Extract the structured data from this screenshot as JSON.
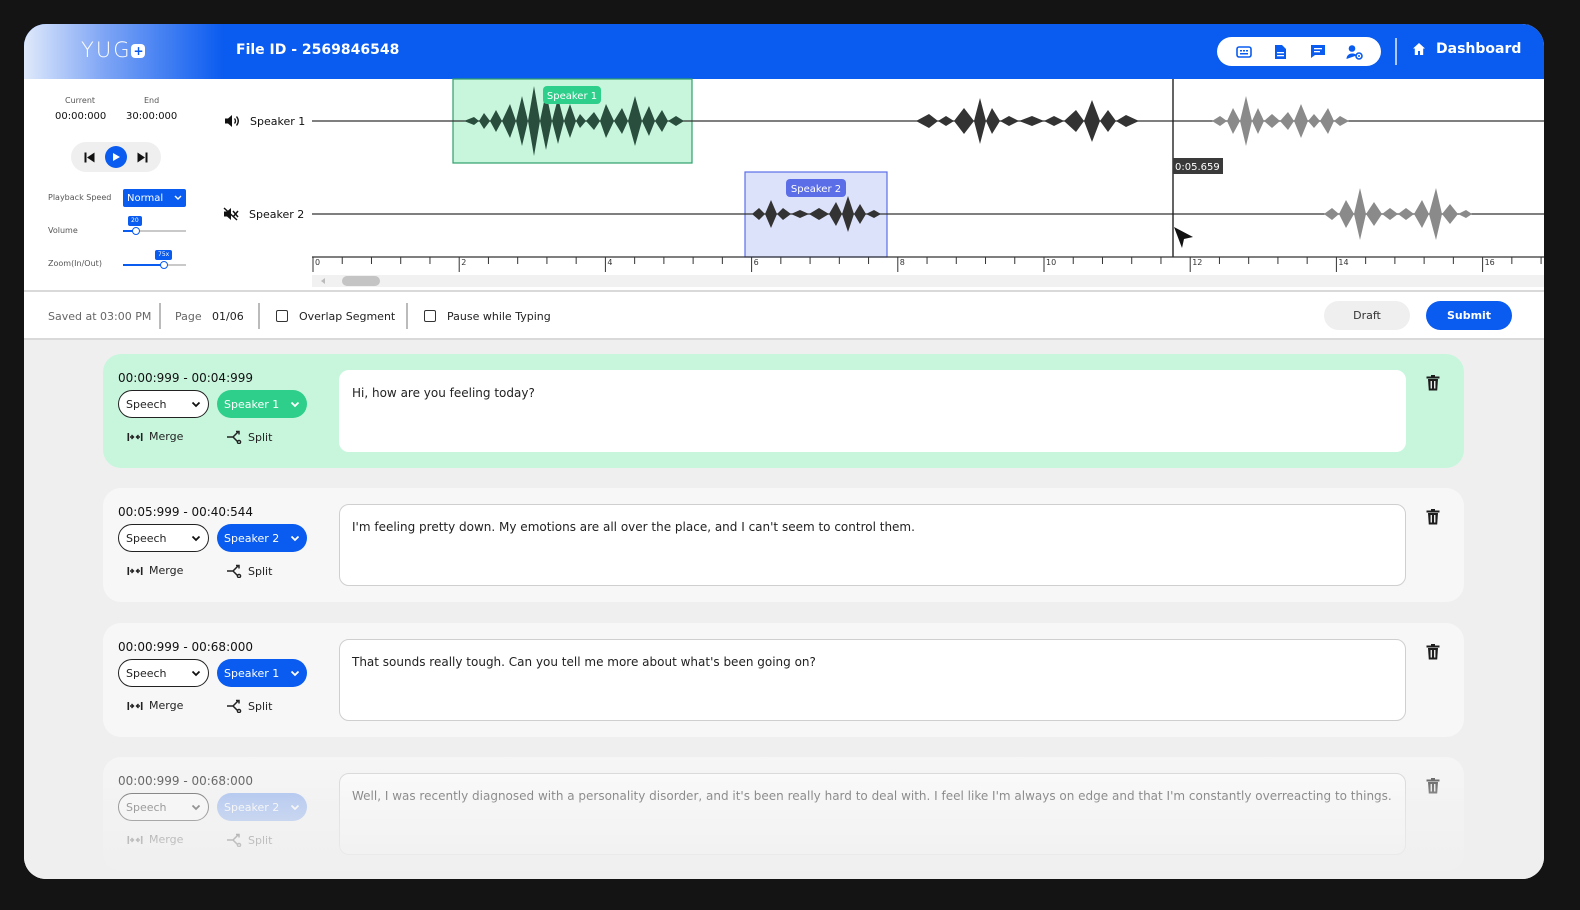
{
  "header": {
    "logo_text": "YUG",
    "logo_plus": "+",
    "file_id": "File ID - 2569846548",
    "tools": [
      "keyboard-icon",
      "document-icon",
      "comment-icon",
      "user-settings-icon"
    ],
    "dashboard_label": "Dashboard"
  },
  "player": {
    "current_label": "Current",
    "current_value": "00:00:000",
    "end_label": "End",
    "end_value": "30:00:000",
    "playback_speed_label": "Playback Speed",
    "playback_speed_value": "Normal",
    "volume_label": "Volume",
    "volume_value": "20",
    "zoom_label": "Zoom(In/Out)",
    "zoom_value": "75x"
  },
  "waveform": {
    "tracks": [
      {
        "name": "Speaker 1",
        "muted": false,
        "region_label": "Speaker 1",
        "region_color": "#2ecf8a"
      },
      {
        "name": "Speaker 2",
        "muted": true,
        "region_label": "Speaker 2",
        "region_color": "#5b6ee8"
      }
    ],
    "cursor_time": "0:05.659",
    "ticks": [
      "0",
      "2",
      "4",
      "6",
      "8",
      "10",
      "12",
      "14",
      "16"
    ]
  },
  "toolbar": {
    "saved_text": "Saved at 03:00 PM",
    "page_label": "Page",
    "page_value": "01/06",
    "overlap_label": "Overlap Segment",
    "pause_label": "Pause while Typing",
    "draft_label": "Draft",
    "submit_label": "Submit"
  },
  "segments": [
    {
      "time": "00:00:999  -  00:04:999",
      "type": "Speech",
      "speaker": "Speaker 1",
      "speaker_color": "#2ecf8a",
      "text": "Hi, how are you feeling today?",
      "merge": "Merge",
      "split": "Split"
    },
    {
      "time": "00:05:999  -  00:40:544",
      "type": "Speech",
      "speaker": "Speaker 2",
      "speaker_color": "#0a5bf0",
      "text": "I'm feeling pretty down. My emotions are all over the place, and I can't seem to control them.",
      "merge": "Merge",
      "split": "Split"
    },
    {
      "time": "00:00:999  -  00:68:000",
      "type": "Speech",
      "speaker": "Speaker 1",
      "speaker_color": "#0a5bf0",
      "text": "That sounds really tough. Can you tell me more about what's been going on?",
      "merge": "Merge",
      "split": "Split"
    },
    {
      "time": "00:00:999  -  00:68:000",
      "type": "Speech",
      "speaker": "Speaker 2",
      "speaker_color": "#0a5bf0",
      "text": "Well, I was recently diagnosed with a personality disorder, and it's been really hard to deal with. I feel like I'm always on edge and that I'm constantly overreacting to things.",
      "merge": "Merge",
      "split": "Split"
    }
  ],
  "colors": {
    "brand": "#0a5bf0",
    "speaker1_region": "#c8f6dd",
    "speaker2_region": "#dde2fb"
  }
}
